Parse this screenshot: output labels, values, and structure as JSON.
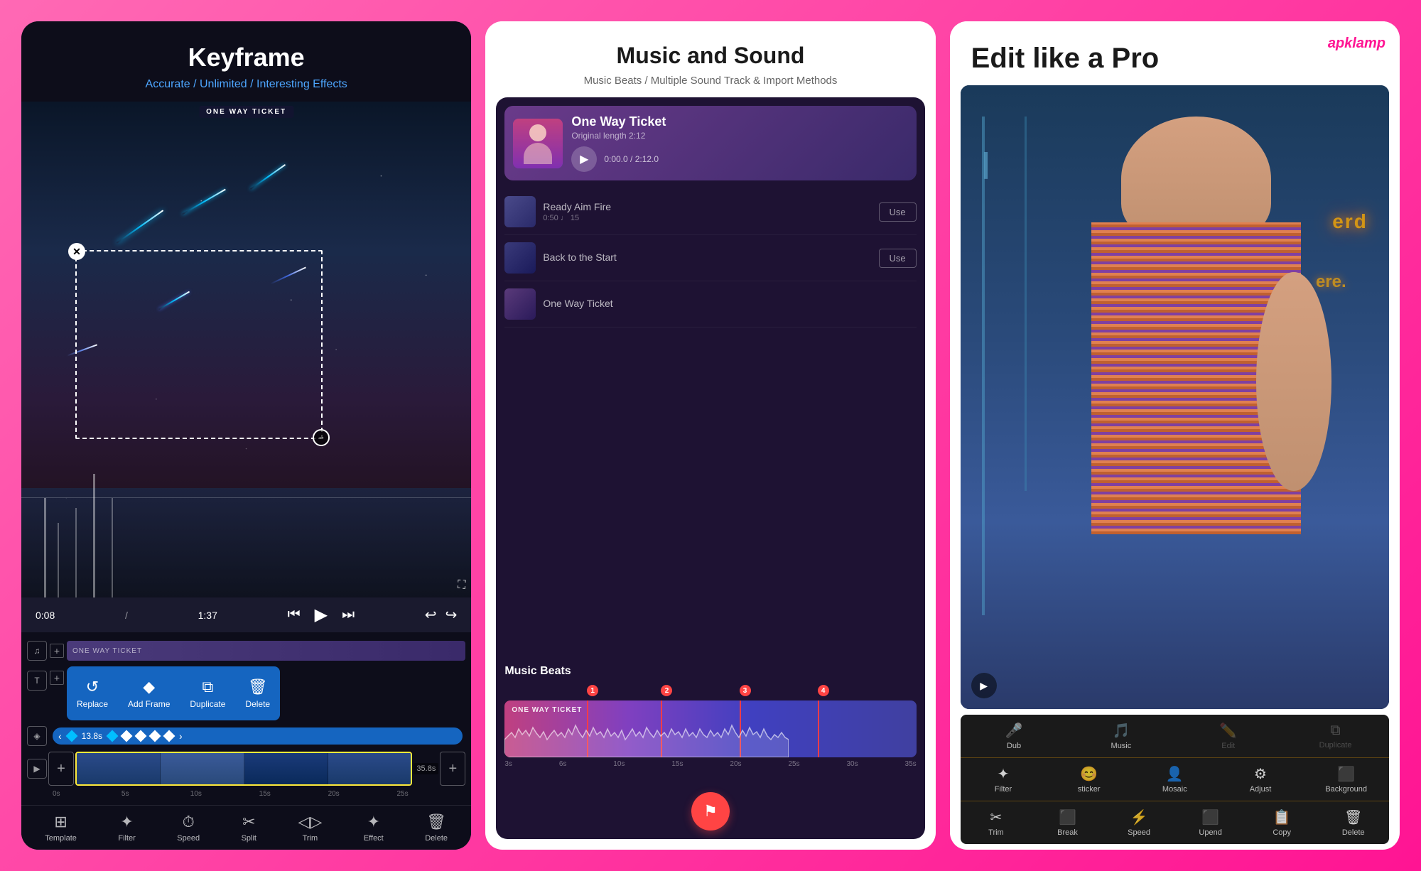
{
  "screens": [
    {
      "id": "keyframe",
      "header": {
        "title": "Keyframe",
        "subtitle": "Accurate / Unlimited / Interesting Effects"
      },
      "transport": {
        "time_current": "0:08",
        "time_total": "1:37"
      },
      "popup_menu": {
        "items": [
          "Replace",
          "Add Frame",
          "Duplicate",
          "Delete"
        ]
      },
      "popup_icons": [
        "↺",
        "◆",
        "⧉",
        "🗑"
      ],
      "timeline": {
        "keyframe_time": "13.8s",
        "segment_time": "35.8s",
        "ruler_marks": [
          "0s",
          "5s",
          "10s",
          "15s",
          "20s",
          "25s"
        ]
      },
      "bottom_toolbar": {
        "items": [
          "Template",
          "Filter",
          "Speed",
          "Split",
          "Trim",
          "Effect",
          "Delete"
        ]
      }
    },
    {
      "id": "music",
      "header": {
        "title": "Music and Sound",
        "subtitle": "Music Beats / Multiple Sound Track & Import Methods"
      },
      "now_playing": {
        "title": "One Way Ticket",
        "length_label": "Original length 2:12",
        "time": "0:00.0 / 2:12.0"
      },
      "tracks": [
        {
          "name": "Ready Aim Fire",
          "meta": "0:50  ♩ 15",
          "has_use": true
        },
        {
          "name": "Back to the Start",
          "meta": "",
          "has_use": true
        },
        {
          "name": "One Way Ticket",
          "meta": "",
          "has_use": false
        }
      ],
      "beats": {
        "title": "Music Beats",
        "track_label": "ONE WAY TICKET",
        "markers": [
          1,
          2,
          3,
          4
        ],
        "ruler": [
          "3s",
          "6s",
          "10s",
          "15s",
          "20s",
          "25s",
          "30s",
          "35s"
        ]
      }
    },
    {
      "id": "edit_pro",
      "apklamp": "apklamp",
      "header": {
        "title": "Edit like a Pro"
      },
      "toolbar_rows": [
        {
          "items": [
            {
              "label": "Dub",
              "icon": "🎤",
              "disabled": false
            },
            {
              "label": "Music",
              "icon": "🎵",
              "disabled": false
            },
            {
              "label": "Edit",
              "icon": "✏️",
              "disabled": true
            },
            {
              "label": "Duplicate",
              "icon": "⧉",
              "disabled": true
            }
          ]
        },
        {
          "items": [
            {
              "label": "Filter",
              "icon": "✦",
              "disabled": false
            },
            {
              "label": "sticker",
              "icon": "😊",
              "disabled": false
            },
            {
              "label": "Mosaic",
              "icon": "👤",
              "disabled": false
            },
            {
              "label": "Adjust",
              "icon": "⚙",
              "disabled": false
            },
            {
              "label": "Background",
              "icon": "⬛",
              "disabled": false
            }
          ]
        },
        {
          "items": [
            {
              "label": "Trim",
              "icon": "✂",
              "disabled": false
            },
            {
              "label": "Break",
              "icon": "⬛",
              "disabled": false
            },
            {
              "label": "Speed",
              "icon": "⚡",
              "disabled": false
            },
            {
              "label": "Upend",
              "icon": "⬛",
              "disabled": false
            },
            {
              "label": "Copy",
              "icon": "📋",
              "disabled": false
            },
            {
              "label": "Delete",
              "icon": "🗑",
              "disabled": false
            }
          ]
        }
      ]
    }
  ]
}
